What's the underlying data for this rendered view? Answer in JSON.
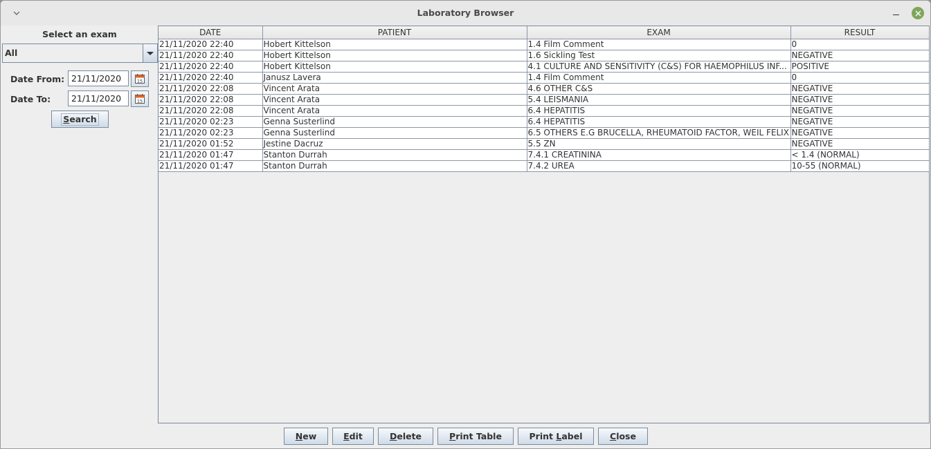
{
  "window": {
    "title": "Laboratory Browser"
  },
  "filters": {
    "exam_label": "Select an exam",
    "exam_selected": "All",
    "date_from_label": "Date From:",
    "date_from_value": "21/11/2020",
    "date_to_label": "Date To:",
    "date_to_value": "21/11/2020",
    "search_button": {
      "mnemonic": "S",
      "rest": "earch"
    },
    "calendar_icon_day": "15"
  },
  "table": {
    "columns": [
      "DATE",
      "PATIENT",
      "EXAM",
      "RESULT"
    ],
    "rows": [
      [
        "21/11/2020 22:40",
        "Hobert Kittelson",
        "1.4 Film Comment",
        "0"
      ],
      [
        "21/11/2020 22:40",
        "Hobert Kittelson",
        "1.6 Sickling Test",
        "NEGATIVE"
      ],
      [
        "21/11/2020 22:40",
        "Hobert Kittelson",
        "4.1 CULTURE AND SENSITIVITY (C&S) FOR HAEMOPHILUS INF...",
        "POSITIVE"
      ],
      [
        "21/11/2020 22:40",
        "Janusz Lavera",
        "1.4 Film Comment",
        "0"
      ],
      [
        "21/11/2020 22:08",
        "Vincent Arata",
        "4.6 OTHER C&S",
        "NEGATIVE"
      ],
      [
        "21/11/2020 22:08",
        "Vincent Arata",
        "5.4 LEISMANIA",
        "NEGATIVE"
      ],
      [
        "21/11/2020 22:08",
        "Vincent Arata",
        "6.4 HEPATITIS",
        "NEGATIVE"
      ],
      [
        "21/11/2020 02:23",
        "Genna Susterlind",
        "6.4 HEPATITIS",
        "NEGATIVE"
      ],
      [
        "21/11/2020 02:23",
        "Genna Susterlind",
        "6.5 OTHERS E.G BRUCELLA, RHEUMATOID FACTOR, WEIL FELIX",
        "NEGATIVE"
      ],
      [
        "21/11/2020 01:52",
        "Jestine Dacruz",
        "5.5 ZN",
        "NEGATIVE"
      ],
      [
        "21/11/2020 01:47",
        "Stanton Durrah",
        "7.4.1 CREATININA",
        "< 1.4 (NORMAL)"
      ],
      [
        "21/11/2020 01:47",
        "Stanton Durrah",
        "7.4.2 UREA",
        "10-55 (NORMAL)"
      ]
    ]
  },
  "buttons": {
    "new": {
      "pre": "",
      "mnemonic": "N",
      "rest": "ew"
    },
    "edit": {
      "pre": "",
      "mnemonic": "E",
      "rest": "dit"
    },
    "delete": {
      "pre": "",
      "mnemonic": "D",
      "rest": "elete"
    },
    "print_table": {
      "pre": "",
      "mnemonic": "P",
      "rest": "rint Table"
    },
    "print_label": {
      "pre": "Print ",
      "mnemonic": "L",
      "rest": "abel"
    },
    "close": {
      "pre": "",
      "mnemonic": "C",
      "rest": "lose"
    }
  },
  "colors": {
    "close_button": "#7fa55a",
    "calendar_accent": "#e0662a"
  }
}
